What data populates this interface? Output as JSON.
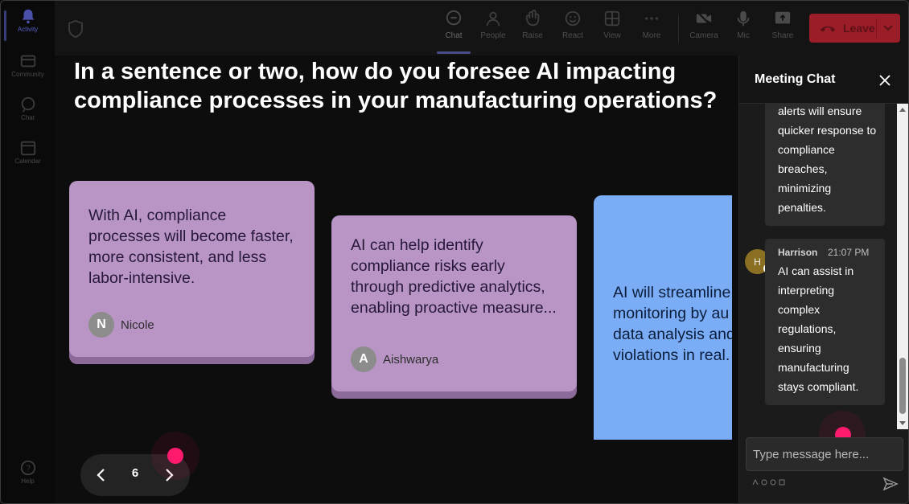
{
  "rail": {
    "items": [
      {
        "label": "Activity",
        "icon": "bell-icon"
      },
      {
        "label": "Community",
        "icon": "community-icon"
      },
      {
        "label": "Chat",
        "icon": "chat-icon"
      },
      {
        "label": "Calendar",
        "icon": "calendar-icon"
      }
    ],
    "help_label": "Help"
  },
  "toolbar": {
    "chat": "Chat",
    "people": "People",
    "raise": "Raise",
    "react": "React",
    "view": "View",
    "more": "More",
    "camera": "Camera",
    "mic": "Mic",
    "share": "Share",
    "leave": "Leave"
  },
  "stage": {
    "question": "In a sentence or two, how do you foresee AI impacting compliance processes in your manufacturing operations?",
    "cards": [
      {
        "text": "With AI, compliance processes will become faster, more consistent, and less labor-intensive.",
        "initial": "N",
        "author": "Nicole"
      },
      {
        "text": "AI can help identify compliance risks early through predictive analytics, enabling proactive measure...",
        "initial": "A",
        "author": "Aishwarya"
      },
      {
        "text": "AI will streamline monitoring by au data analysis and violations in real."
      }
    ],
    "page": "6"
  },
  "chat": {
    "title": "Meeting Chat",
    "messages": [
      {
        "text": "alerts will ensure quicker response to compliance breaches, minimizing penalties."
      },
      {
        "initial": "H",
        "sender": "Harrison",
        "time": "21:07 PM",
        "text": "AI can assist in interpreting complex regulations, ensuring manufacturing stays compliant."
      }
    ],
    "placeholder": "Type message here..."
  },
  "colors": {
    "card_purple": "#b895c4",
    "card_blue": "#7badf7",
    "leave_red": "#9b1d27",
    "pointer_pink": "#ff1a6e",
    "accent": "#5b5fc7"
  }
}
